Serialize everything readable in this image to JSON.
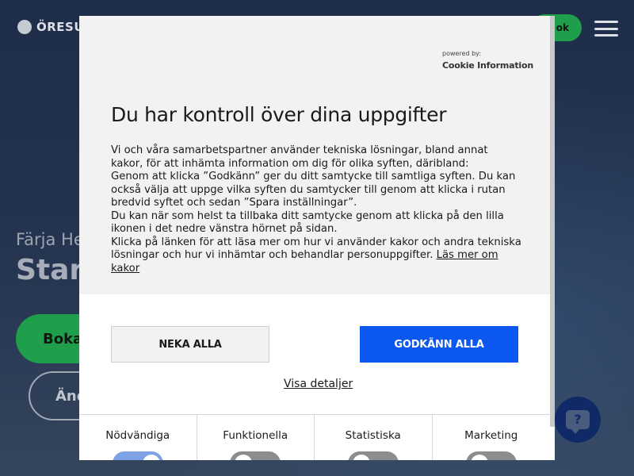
{
  "background": {
    "logo_text": "ÖRESUN",
    "header_button_label": "ok",
    "eyebrow": "Färja He",
    "headline": "Start",
    "cta_primary": "Boka",
    "cta_secondary": "Änd",
    "help_label": "?"
  },
  "consent": {
    "powered_by": "powered by:",
    "brand": "Cookie Information",
    "title": "Du har kontroll över dina uppgifter",
    "paragraphs": [
      "Vi och våra samarbetspartner använder tekniska lösningar, bland annat kakor, för att inhämta information om dig för olika syften, däribland:",
      "Genom att klicka ”Godkänn” ger du ditt samtycke till samtliga syften. Du kan också välja att uppge vilka syften du samtycker till genom att klicka i rutan bredvid syftet och sedan ”Spara inställningar”.",
      "Du kan när som helst ta tillbaka ditt samtycke genom att klicka på den lilla ikonen i det nedre vänstra hörnet på sidan.",
      "Klicka på länken för att läsa mer om hur vi använder kakor och andra tekniska lösningar och hur vi inhämtar och behandlar personuppgifter."
    ],
    "learn_more_link": "Läs mer om kakor",
    "deny_all": "NEKA ALLA",
    "accept_all": "GODKÄNN ALLA",
    "show_details": "Visa detaljer",
    "categories": [
      {
        "label": "Nödvändiga",
        "enabled": true
      },
      {
        "label": "Funktionella",
        "enabled": false
      },
      {
        "label": "Statistiska",
        "enabled": false
      },
      {
        "label": "Marketing",
        "enabled": false
      }
    ]
  },
  "colors": {
    "accept_button": "#0b57f0",
    "toggle_on": "#7fa2e6",
    "toggle_off": "#8d8d8d",
    "brand_green": "#1f9e4b"
  }
}
